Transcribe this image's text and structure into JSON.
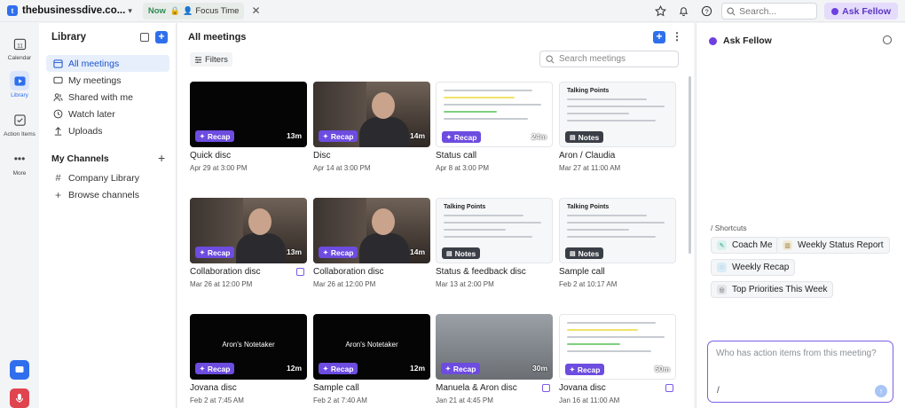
{
  "topbar": {
    "workspace": "thebusinessdive.co...",
    "now_label": "Now",
    "focus_label": "Focus Time",
    "search_placeholder": "Search...",
    "ask_fellow_label": "Ask Fellow"
  },
  "rail": {
    "items": [
      {
        "label": "Calendar",
        "icon": "calendar-icon",
        "day": "11"
      },
      {
        "label": "Library",
        "icon": "library-icon"
      },
      {
        "label": "Action Items",
        "icon": "checkbox-icon"
      },
      {
        "label": "More",
        "icon": "more-icon"
      }
    ]
  },
  "library": {
    "title": "Library",
    "nav": [
      {
        "label": "All meetings",
        "icon": "calendar-icon"
      },
      {
        "label": "My meetings",
        "icon": "video-icon"
      },
      {
        "label": "Shared with me",
        "icon": "people-icon"
      },
      {
        "label": "Watch later",
        "icon": "clock-icon"
      },
      {
        "label": "Uploads",
        "icon": "upload-icon"
      }
    ],
    "channels_title": "My Channels",
    "channels": [
      {
        "label": "Company Library",
        "icon": "hash-icon"
      },
      {
        "label": "Browse channels",
        "icon": "plus-icon"
      }
    ]
  },
  "main": {
    "title": "All meetings",
    "filters_label": "Filters",
    "search_placeholder": "Search meetings",
    "cards": [
      {
        "title": "Quick disc",
        "date": "Apr 29 at 3:00 PM",
        "badge": "Recap",
        "duration": "13m",
        "thumb": "dark"
      },
      {
        "title": "Disc",
        "date": "Apr 14 at 3:00 PM",
        "badge": "Recap",
        "duration": "14m",
        "thumb": "person"
      },
      {
        "title": "Status call",
        "date": "Apr 8 at 3:00 PM",
        "badge": "Recap",
        "duration": "24m",
        "thumb": "screen"
      },
      {
        "title": "Aron / Claudia",
        "date": "Mar 27 at 11:00 AM",
        "badge": "Notes",
        "duration": "",
        "thumb": "doc",
        "doc_heading": "Talking Points"
      },
      {
        "title": "Collaboration disc",
        "date": "Mar 26 at 12:00 PM",
        "badge": "Recap",
        "duration": "13m",
        "thumb": "person",
        "note": true
      },
      {
        "title": "Collaboration disc",
        "date": "Mar 26 at 12:00 PM",
        "badge": "Recap",
        "duration": "14m",
        "thumb": "person"
      },
      {
        "title": "Status & feedback disc",
        "date": "Mar 13 at 2:00 PM",
        "badge": "Notes",
        "duration": "",
        "thumb": "doc",
        "doc_heading": "Talking Points"
      },
      {
        "title": "Sample call",
        "date": "Feb 2 at 10:17 AM",
        "badge": "Notes",
        "duration": "",
        "thumb": "doc",
        "doc_heading": "Talking Points"
      },
      {
        "title": "Jovana disc",
        "date": "Feb 2 at 7:45 AM",
        "badge": "Recap",
        "duration": "12m",
        "thumb": "dark",
        "overlay": "Aron's Notetaker"
      },
      {
        "title": "Sample call",
        "date": "Feb 2 at 7:40 AM",
        "badge": "Recap",
        "duration": "12m",
        "thumb": "dark",
        "overlay": "Aron's Notetaker"
      },
      {
        "title": "Manuela & Aron disc",
        "date": "Jan 21 at 4:45 PM",
        "badge": "Recap",
        "duration": "30m",
        "thumb": "man2",
        "note": true
      },
      {
        "title": "Jovana disc",
        "date": "Jan 16 at 11:00 AM",
        "badge": "Recap",
        "duration": "50m",
        "thumb": "screen",
        "note": true
      }
    ]
  },
  "ask": {
    "title": "Ask Fellow",
    "shortcuts_label": "/ Shortcuts",
    "shortcuts": [
      {
        "label": "Coach Me",
        "icon": "coach-icon",
        "color": "#d9f1ec"
      },
      {
        "label": "Weekly Status Report",
        "icon": "chart-icon",
        "color": "#f0ead9"
      },
      {
        "label": "Weekly Recap",
        "icon": "chat-icon",
        "color": "#d9ecf5"
      },
      {
        "label": "Top Priorities This Week",
        "icon": "target-icon",
        "color": "#e3e3e8"
      }
    ],
    "input_placeholder": "Who has action items from this meeting?",
    "slash_hint": "/"
  }
}
